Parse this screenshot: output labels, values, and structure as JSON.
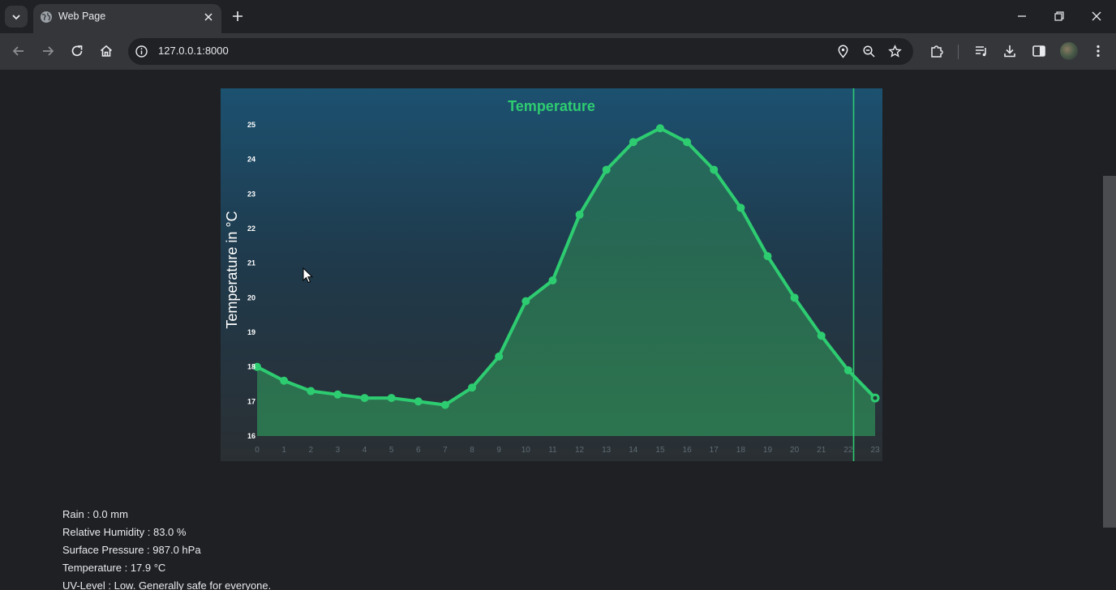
{
  "browser": {
    "tab": {
      "title": "Web Page",
      "favicon_icon": "globe-icon"
    },
    "address_bar": {
      "url": "127.0.0.1:8000"
    },
    "icons": {
      "tab_search": "chevron-down-icon",
      "new_tab": "plus-icon",
      "close_tab": "close-icon",
      "back": "arrow-left-icon",
      "forward": "arrow-right-icon",
      "reload": "reload-icon",
      "home": "home-icon",
      "site_info": "info-icon",
      "location": "location-pin-icon",
      "zoom": "zoom-out-icon",
      "bookmark": "star-icon",
      "extensions": "puzzle-icon",
      "media": "media-queue-icon",
      "downloads": "download-icon",
      "side_panel": "side-panel-icon",
      "menu": "kebab-menu-icon"
    }
  },
  "chart_data": {
    "type": "area",
    "title": "Temperature",
    "ylabel": "Temperature in °C",
    "xlabel": "",
    "x": [
      0,
      1,
      2,
      3,
      4,
      5,
      6,
      7,
      8,
      9,
      10,
      11,
      12,
      13,
      14,
      15,
      16,
      17,
      18,
      19,
      20,
      21,
      22,
      23
    ],
    "values": [
      18.0,
      17.6,
      17.3,
      17.2,
      17.1,
      17.1,
      17.0,
      16.9,
      17.4,
      18.3,
      19.9,
      20.5,
      22.4,
      23.7,
      24.5,
      24.9,
      24.5,
      23.7,
      22.6,
      21.2,
      20.0,
      18.9,
      17.9,
      17.1
    ],
    "ylim": [
      16,
      25
    ],
    "yticks": [
      16,
      17,
      18,
      19,
      20,
      21,
      22,
      23,
      24,
      25
    ],
    "current_hour": 22,
    "highlighted_hour": 23,
    "grid": false,
    "colors": {
      "line": "#2ecc71",
      "fill": "#2e8b57",
      "title": "#2ecc71",
      "marker_line": "#2ecc71"
    }
  },
  "weather": {
    "rain": "Rain : 0.0 mm",
    "humidity": "Relative Humidity : 83.0 %",
    "pressure": "Surface Pressure : 987.0 hPa",
    "temperature": "Temperature : 17.9 °C",
    "uv": "UV-Level : Low. Generally safe for everyone."
  }
}
